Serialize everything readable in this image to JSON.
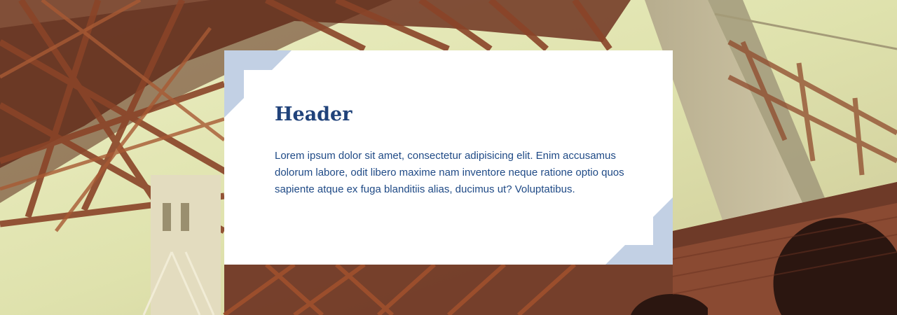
{
  "hero": {
    "background_image": "golden-gate-bridge-steel-truss-photo"
  },
  "card": {
    "title": "Header",
    "body": "Lorem ipsum dolor sit amet, consectetur adipisicing elit. Enim accusamus dolorum labore, odit libero maxime nam inventore neque ratione optio quos sapiente atque ex fuga blanditiis alias, ducimus ut? Voluptatibus.",
    "corner_icon": "corner-bracket-decoration"
  },
  "colors": {
    "title": "#20427a",
    "body_text": "#1f4a86",
    "corner_accent": "#c2d0e4",
    "card_background": "#ffffff",
    "steel": "#7a3a22",
    "sky": "#e8ebbe"
  }
}
